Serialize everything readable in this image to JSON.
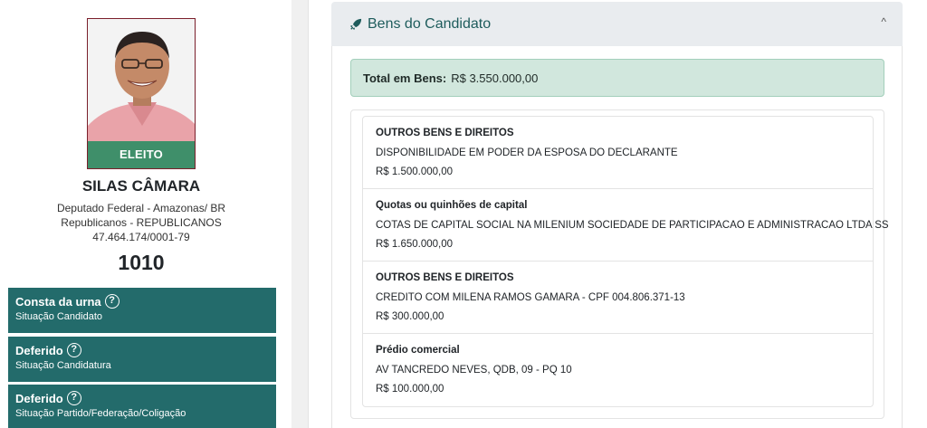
{
  "candidate": {
    "status_label": "ELEITO",
    "name": "SILAS CÂMARA",
    "office": "Deputado Federal - Amazonas/ BR",
    "party": "Republicanos - REPUBLICANOS",
    "cnpj": "47.464.174/0001-79",
    "number": "1010"
  },
  "status_boxes": [
    {
      "title": "Consta da urna",
      "subtitle": "Situação Candidato"
    },
    {
      "title": "Deferido",
      "subtitle": "Situação Candidatura"
    },
    {
      "title": "Deferido",
      "subtitle": "Situação Partido/Federação/Coligação"
    }
  ],
  "assets": {
    "title": "Bens do Candidato",
    "total_label": "Total em Bens:",
    "total_value": "R$ 3.550.000,00",
    "items": [
      {
        "type": "OUTROS BENS E DIREITOS",
        "description": "DISPONIBILIDADE EM PODER DA ESPOSA DO DECLARANTE",
        "value": "R$ 1.500.000,00"
      },
      {
        "type": "Quotas ou quinhões de capital",
        "description": "COTAS DE CAPITAL SOCIAL NA MILENIUM SOCIEDADE DE PARTICIPACAO E ADMINISTRACAO LTDA SS",
        "value": "R$ 1.650.000,00"
      },
      {
        "type": "OUTROS BENS E DIREITOS",
        "description": "CREDITO COM MILENA RAMOS GAMARA - CPF 004.806.371-13",
        "value": "R$ 300.000,00"
      },
      {
        "type": "Prédio comercial",
        "description": "AV TANCREDO NEVES, QDB, 09 - PQ 10",
        "value": "R$ 100.000,00"
      }
    ]
  },
  "icons": {
    "help": "question-circle-icon",
    "rocket": "rocket-icon",
    "collapse": "chevron-up-icon"
  },
  "colors": {
    "teal": "#236b6b",
    "elected_green": "#3f8f6a",
    "total_bg": "#d1e7dd"
  }
}
